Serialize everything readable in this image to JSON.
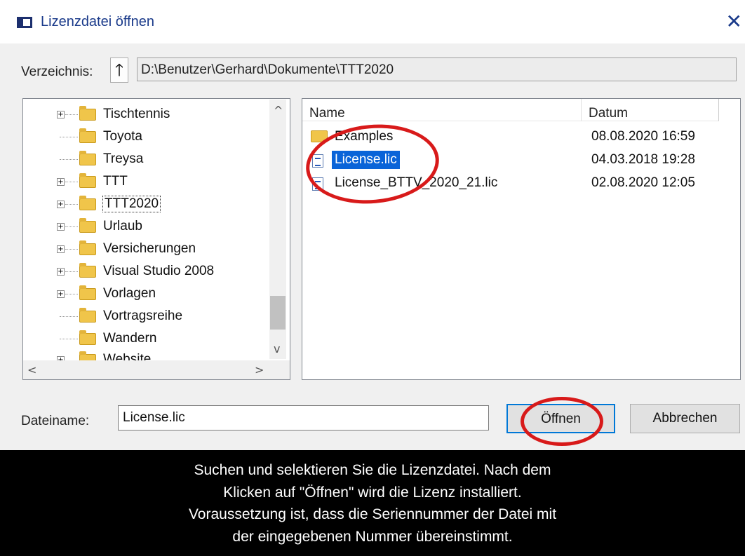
{
  "window": {
    "title": "Lizenzdatei öffnen",
    "close_glyph": "✕"
  },
  "directory": {
    "label": "Verzeichnis:",
    "up_glyph": "🡑",
    "path": "D:\\Benutzer\\Gerhard\\Dokumente\\TTT2020"
  },
  "tree": {
    "items": [
      {
        "label": "Tischtennis",
        "expandable": true
      },
      {
        "label": "Toyota",
        "expandable": false
      },
      {
        "label": "Treysa",
        "expandable": false
      },
      {
        "label": "TTT",
        "expandable": true
      },
      {
        "label": "TTT2020",
        "expandable": true,
        "selected": true
      },
      {
        "label": "Urlaub",
        "expandable": true
      },
      {
        "label": "Versicherungen",
        "expandable": true
      },
      {
        "label": "Visual Studio 2008",
        "expandable": true
      },
      {
        "label": "Vorlagen",
        "expandable": true
      },
      {
        "label": "Vortragsreihe",
        "expandable": false
      },
      {
        "label": "Wandern",
        "expandable": false
      },
      {
        "label": "Website",
        "expandable": true
      }
    ],
    "scroll_up": "^",
    "scroll_down": "v",
    "scroll_left": "<",
    "scroll_right": ">"
  },
  "list": {
    "columns": {
      "name": "Name",
      "date": "Datum"
    },
    "rows": [
      {
        "name": "Examples",
        "date": "08.08.2020 16:59",
        "type": "folder"
      },
      {
        "name": "License.lic",
        "date": "04.03.2018 19:28",
        "type": "file",
        "selected": true
      },
      {
        "name": "License_BTTV_2020_21.lic",
        "date": "02.08.2020 12:05",
        "type": "file"
      }
    ]
  },
  "filename": {
    "label": "Dateiname:",
    "value": "License.lic"
  },
  "buttons": {
    "open": "Öffnen",
    "cancel": "Abbrechen"
  },
  "caption": {
    "lines": [
      "Suchen und selektieren Sie die Lizenzdatei. Nach dem",
      "Klicken auf \"Öffnen\" wird die Lizenz installiert.",
      "Voraussetzung ist, dass die Seriennummer der Datei mit",
      "der eingegebenen Nummer übereinstimmt."
    ]
  },
  "colors": {
    "highlight": "#d81a1a",
    "selection": "#0a64d8",
    "title_text": "#1a3a8a"
  }
}
